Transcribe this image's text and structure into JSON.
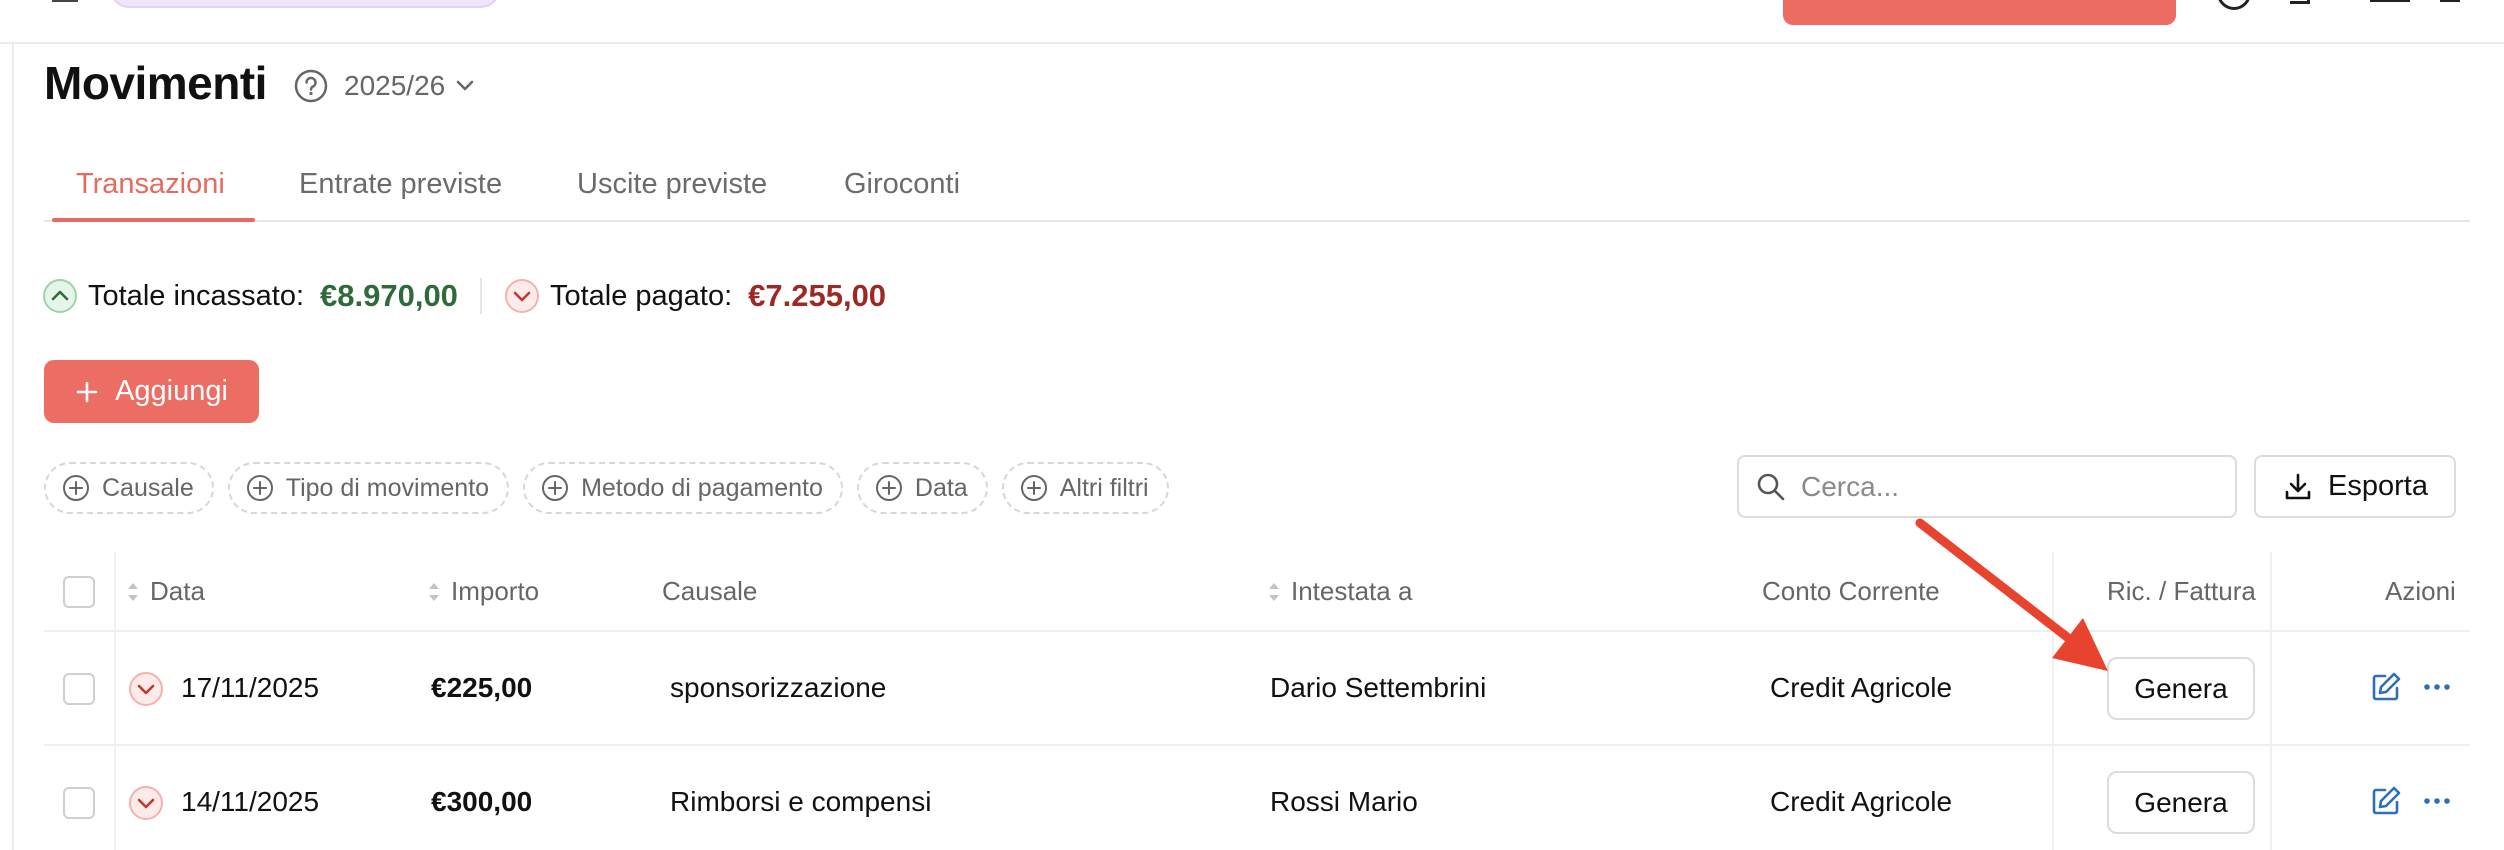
{
  "page": {
    "title": "Movimenti",
    "year": "2025/26"
  },
  "tabs": [
    {
      "label": "Transazioni",
      "active": true
    },
    {
      "label": "Entrate previste",
      "active": false
    },
    {
      "label": "Uscite previste",
      "active": false
    },
    {
      "label": "Giroconti",
      "active": false
    }
  ],
  "totals": {
    "income_label": "Totale incassato:",
    "income_value": "€8.970,00",
    "expense_label": "Totale pagato:",
    "expense_value": "€7.255,00",
    "income_color": "#2f6b3a",
    "expense_color": "#9b2a24"
  },
  "toolbar": {
    "add_label": "Aggiungi",
    "search_placeholder": "Cerca...",
    "export_label": "Esporta"
  },
  "filters": [
    "Causale",
    "Tipo di movimento",
    "Metodo di pagamento",
    "Data",
    "Altri filtri"
  ],
  "table": {
    "headers": {
      "data": "Data",
      "importo": "Importo",
      "causale": "Causale",
      "intestata": "Intestata a",
      "conto": "Conto Corrente",
      "fattura": "Ric. / Fattura",
      "azioni": "Azioni"
    },
    "rows": [
      {
        "date": "17/11/2025",
        "amount": "€225,00",
        "causale": "sponsorizzazione",
        "intestata": "Dario Settembrini",
        "conto": "Credit Agricole",
        "action": "Genera",
        "direction": "out"
      },
      {
        "date": "14/11/2025",
        "amount": "€300,00",
        "causale": "Rimborsi e compensi",
        "intestata": "Rossi Mario",
        "conto": "Credit Agricole",
        "action": "Genera",
        "direction": "out"
      }
    ]
  },
  "colors": {
    "accent": "#e8695f",
    "add_button": "#ec6d64",
    "arrow": "#e8432e",
    "edit_icon": "#2f6fb6"
  },
  "icons": {
    "help": "question-circle-icon",
    "year": "chevron-down-icon",
    "income": "chevron-up-circle-icon",
    "expense": "chevron-down-circle-icon",
    "add": "plus-icon",
    "filter": "plus-circle-icon",
    "search": "search-icon",
    "export": "download-icon",
    "edit": "edit-icon",
    "more": "more-horizontal-icon"
  }
}
